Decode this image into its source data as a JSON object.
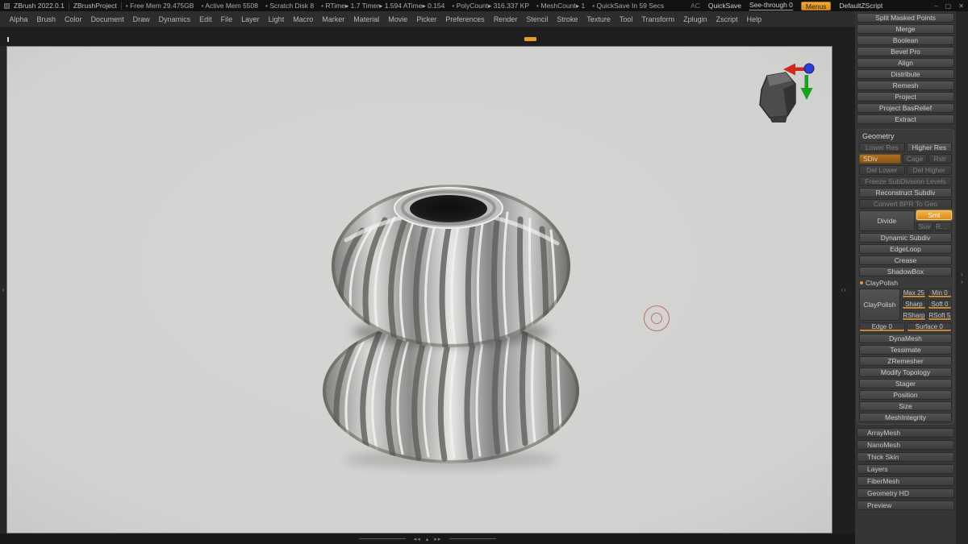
{
  "colors": {
    "accent": "#e89a2a",
    "canvas-bg": "#d2d2d1"
  },
  "title_bar": {
    "app_title": "ZBrush 2022.0.1",
    "project_name": "ZBrushProject",
    "stats": [
      "Free Mem 29.475GB",
      "Active Mem 5508",
      "Scratch Disk 8",
      "RTime▸ 1.7  Timer▸ 1.594  ATime▸ 0.154",
      "PolyCount▸ 316.337 KP",
      "MeshCount▸ 1",
      "QuickSave In 59 Secs"
    ],
    "ac_label": "AC",
    "quicksave_label": "QuickSave",
    "seethrough_label": "See-through 0",
    "menus_label": "Menus",
    "zscript_label": "DefaultZScript"
  },
  "icons": {
    "minimize": "–",
    "maximize": "▢",
    "close": "✕",
    "divider_left": "‹",
    "divider_right": "›",
    "scroll_left": "◂◂",
    "scroll_up": "▴",
    "scroll_right": "▸▸"
  },
  "menu_bar": {
    "items": [
      "Alpha",
      "Brush",
      "Color",
      "Document",
      "Draw",
      "Dynamics",
      "Edit",
      "File",
      "Layer",
      "Light",
      "Macro",
      "Marker",
      "Material",
      "Movie",
      "Picker",
      "Preferences",
      "Render",
      "Stencil",
      "Stroke",
      "Texture",
      "Tool",
      "Transform",
      "Zplugin",
      "Zscript",
      "Help"
    ]
  },
  "tool_panel": {
    "subtool_buttons": [
      "Split Masked Points",
      "Merge",
      "Boolean",
      "Bevel Pro",
      "Align",
      "Distribute",
      "Remesh",
      "Project",
      "Project BasRelief",
      "Extract"
    ],
    "geometry": {
      "title": "Geometry",
      "lower_res": "Lower Res",
      "higher_res": "Higher Res",
      "sdiv": "SDiv",
      "cage": "Cage",
      "rstr": "Rstr",
      "del_lower": "Del Lower",
      "del_higher": "Del Higher",
      "freeze": "Freeze SubDivision Levels",
      "reconstruct": "Reconstruct Subdiv",
      "convert_bpr": "Convert BPR To Geo",
      "divide": "Divide",
      "smt": "Smt",
      "suv": "Suv",
      "reuv": "ReUV",
      "dynamic_subdiv": "Dynamic Subdiv",
      "edgeloop": "EdgeLoop",
      "crease": "Crease",
      "shadowbox": "ShadowBox",
      "claypolish_header": "ClayPolish",
      "claypolish_button": "ClayPolish",
      "max": "Max 25",
      "min": "Min 0",
      "sharp": "Sharp",
      "soft": "Soft 0",
      "rsharp": "RSharp",
      "rsoft": "RSoft 5",
      "edge": "Edge 0",
      "surface": "Surface 0",
      "dynamesh": "DynaMesh",
      "tessimate": "Tessimate",
      "zremesher": "ZRemesher",
      "modify_topology": "Modify Topology",
      "stager": "Stager",
      "position": "Position",
      "size": "Size",
      "meshintegrity": "MeshIntegrity"
    },
    "collapsed_subpalettes": [
      "ArrayMesh",
      "NanoMesh",
      "Thick Skin",
      "Layers",
      "FiberMesh",
      "Geometry HD",
      "Preview"
    ]
  }
}
